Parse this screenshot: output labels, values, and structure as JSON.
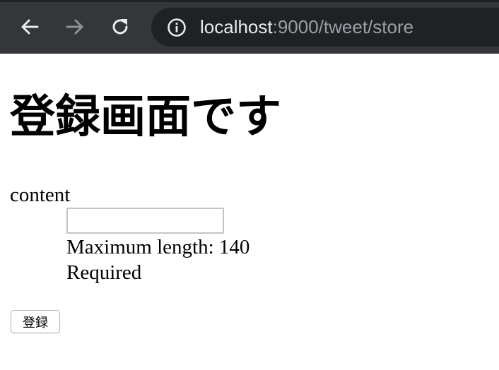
{
  "browser": {
    "url_host": "localhost",
    "url_rest": ":9000/tweet/store",
    "icons": [
      "back-arrow-icon",
      "forward-arrow-icon",
      "reload-icon",
      "info-icon"
    ]
  },
  "page": {
    "heading": "登録画面です",
    "form": {
      "label": "content",
      "input_value": "",
      "constraint_max_length": "Maximum length: 140",
      "constraint_required": "Required",
      "submit_label": "登録"
    }
  }
}
